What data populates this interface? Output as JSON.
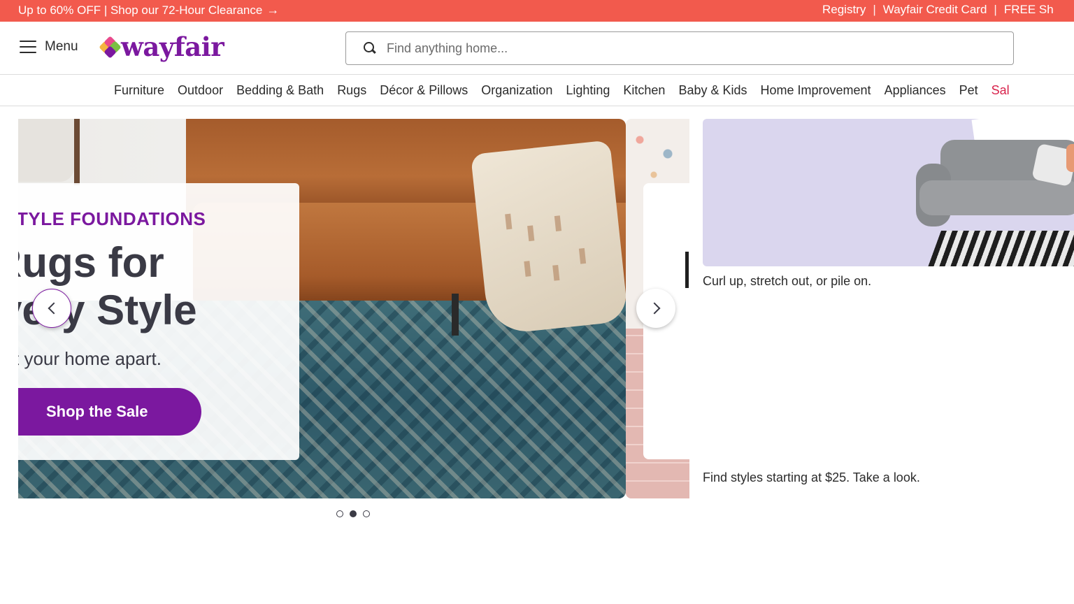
{
  "promo_bar": {
    "message": "Up to 60% OFF | Shop our 72-Hour Clearance",
    "links": [
      "Registry",
      "Wayfair Credit Card",
      "FREE Sh"
    ],
    "separator": "|"
  },
  "header": {
    "menu_label": "Menu",
    "logo_text": "wayfair",
    "search_placeholder": "Find anything home..."
  },
  "categories": [
    "Furniture",
    "Outdoor",
    "Bedding & Bath",
    "Rugs",
    "Décor & Pillows",
    "Organization",
    "Lighting",
    "Kitchen",
    "Baby & Kids",
    "Home Improvement",
    "Appliances",
    "Pet",
    "Sal"
  ],
  "hero": {
    "eyebrow": "TYLE FOUNDATIONS",
    "headline_line1": "ugs for",
    "headline_line2": "ery Style",
    "headline_prefix1": "R",
    "headline_prefix2": "Ev",
    "subline": "t your home apart.",
    "cta_label": "Shop the Sale",
    "dots": 3,
    "active_dot": 2
  },
  "side_tiles": [
    {
      "caption": "Curl up, stretch out, or pile on."
    },
    {
      "caption": "Find styles starting at $25. Take a look."
    }
  ],
  "colors": {
    "promo_bg": "#f25a4d",
    "brand_purple": "#7b189f",
    "sale_red": "#d8224b"
  }
}
